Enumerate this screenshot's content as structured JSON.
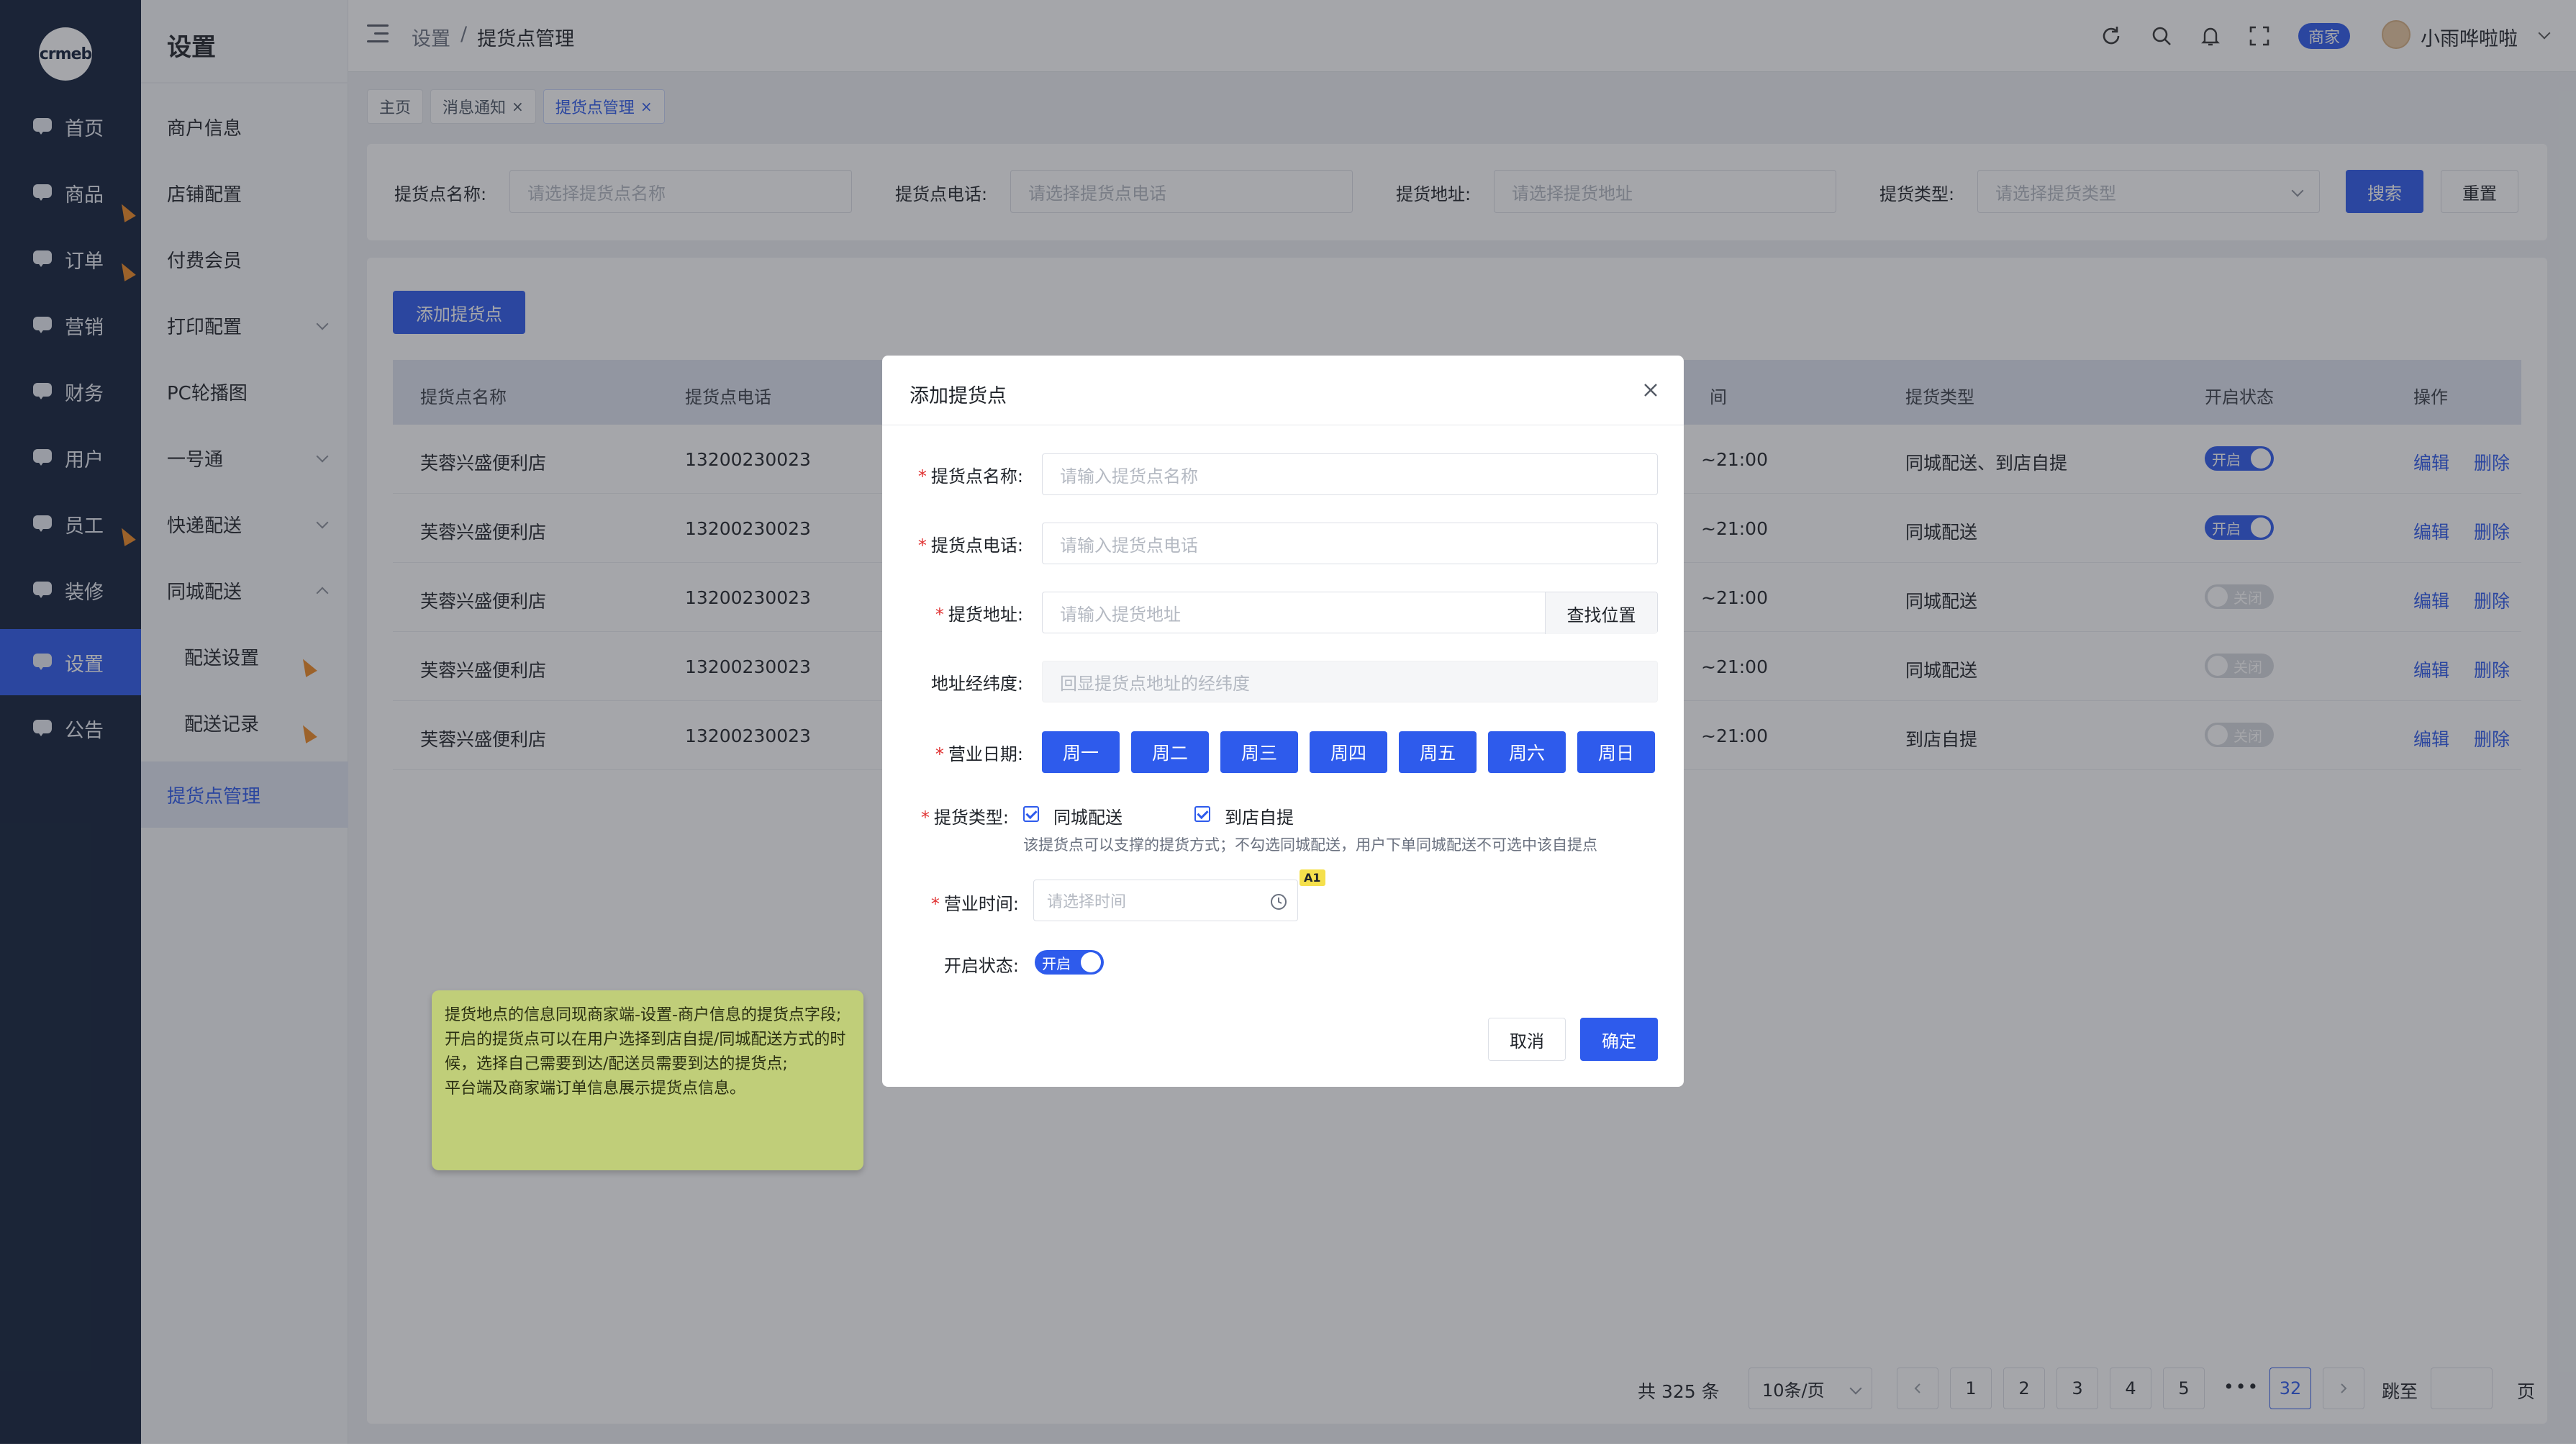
{
  "logo": {
    "text": "crmeb"
  },
  "nav": [
    {
      "label": "首页",
      "icon": "chat-icon"
    },
    {
      "label": "商品",
      "icon": "chat-icon"
    },
    {
      "label": "订单",
      "icon": "chat-icon"
    },
    {
      "label": "营销",
      "icon": "chat-icon"
    },
    {
      "label": "财务",
      "icon": "chat-icon"
    },
    {
      "label": "用户",
      "icon": "chat-icon"
    },
    {
      "label": "员工",
      "icon": "chat-icon"
    },
    {
      "label": "装修",
      "icon": "chat-icon"
    },
    {
      "label": "设置",
      "icon": "chat-icon",
      "active": true
    },
    {
      "label": "公告",
      "icon": "chat-icon"
    }
  ],
  "submenu": {
    "title": "设置",
    "items": [
      {
        "label": "商户信息"
      },
      {
        "label": "店铺配置"
      },
      {
        "label": "付费会员"
      },
      {
        "label": "打印配置",
        "expandable": true
      },
      {
        "label": "PC轮播图"
      },
      {
        "label": "一号通",
        "expandable": true
      },
      {
        "label": "快递配送",
        "expandable": true
      },
      {
        "label": "同城配送",
        "expandable": true
      },
      {
        "label": "配送设置"
      },
      {
        "label": "配送记录"
      },
      {
        "label": "提货点管理",
        "active": true
      }
    ]
  },
  "topbar": {
    "breadcrumb": [
      "设置",
      "/",
      "提货点管理"
    ],
    "merchant_tag": "商家",
    "user_name": "小雨哗啦啦"
  },
  "tabs": [
    {
      "label": "主页",
      "closable": false
    },
    {
      "label": "消息通知",
      "closable": true,
      "close": "×"
    },
    {
      "label": "提货点管理",
      "closable": true,
      "close": "×",
      "active": true
    }
  ],
  "filters": {
    "name_label": "提货点名称:",
    "name_placeholder": "请选择提货点名称",
    "phone_label": "提货点电话:",
    "phone_placeholder": "请选择提货点电话",
    "address_label": "提货地址:",
    "address_placeholder": "请选择提货地址",
    "type_label": "提货类型:",
    "type_placeholder": "请选择提货类型",
    "search_button": "搜索",
    "reset_button": "重置"
  },
  "table": {
    "add_button": "添加提货点",
    "headers": [
      "提货点名称",
      "提货点电话",
      "间",
      "提货类型",
      "开启状态",
      "操作"
    ],
    "rows": [
      {
        "name": "芙蓉兴盛便利店",
        "phone": "13200230023",
        "time": "~21:00",
        "type": "同城配送、到店自提",
        "status": "开启",
        "on": true
      },
      {
        "name": "芙蓉兴盛便利店",
        "phone": "13200230023",
        "time": "~21:00",
        "type": "同城配送",
        "status": "开启",
        "on": true
      },
      {
        "name": "芙蓉兴盛便利店",
        "phone": "13200230023",
        "time": "~21:00",
        "type": "同城配送",
        "status": "关闭",
        "on": false
      },
      {
        "name": "芙蓉兴盛便利店",
        "phone": "13200230023",
        "time": "~21:00",
        "type": "同城配送",
        "status": "关闭",
        "on": false
      },
      {
        "name": "芙蓉兴盛便利店",
        "phone": "13200230023",
        "time": "~21:00",
        "type": "到店自提",
        "status": "关闭",
        "on": false
      }
    ],
    "edit_label": "编辑",
    "delete_label": "删除"
  },
  "pagination": {
    "total": "共 325 条",
    "page_size": "10条/页",
    "pages": [
      "1",
      "2",
      "3",
      "4",
      "5"
    ],
    "ellipsis": "•••",
    "last_page": "32",
    "current": "32",
    "jump_label": "跳至",
    "page_suffix": "页"
  },
  "modal": {
    "title": "添加提货点",
    "name_label": "提货点名称:",
    "name_placeholder": "请输入提货点名称",
    "phone_label": "提货点电话:",
    "phone_placeholder": "请输入提货点电话",
    "address_label": "提货地址:",
    "address_placeholder": "请输入提货地址",
    "find_button": "查找位置",
    "coords_label": "地址经纬度:",
    "coords_placeholder": "回显提货点地址的经纬度",
    "days_label": "营业日期:",
    "days": [
      "周一",
      "周二",
      "周三",
      "周四",
      "周五",
      "周六",
      "周日"
    ],
    "type_label": "提货类型:",
    "type_city": "同城配送",
    "type_pickup": "到店自提",
    "type_hint": "该提货点可以支撑的提货方式；不勾选同城配送，用户下单同城配送不可选中该自提点",
    "time_label": "营业时间:",
    "time_placeholder": "请选择时间",
    "time_tag": "A1",
    "status_label": "开启状态:",
    "status_value": "开启",
    "cancel_button": "取消",
    "confirm_button": "确定"
  },
  "note": {
    "lines": [
      "提货地点的信息同现商家端-设置-商户信息的提货点字段;",
      "开启的提货点可以在用户选择到店自提/同城配送方式的时候，选择自己需要到达/配送员需要到达的提货点;",
      "平台端及商家端订单信息展示提货点信息。"
    ]
  },
  "colors": {
    "primary": "#2e5bec",
    "sidebar": "#12203a",
    "note": "#c0ce79"
  }
}
